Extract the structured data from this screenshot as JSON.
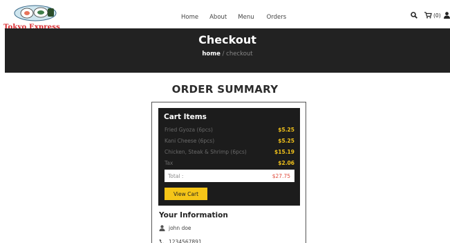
{
  "brand": {
    "name": "Tokyo Express",
    "color": "#d7262b"
  },
  "nav": {
    "items": [
      "Home",
      "About",
      "Menu",
      "Orders"
    ]
  },
  "header": {
    "cart_count": "(0)",
    "icons": [
      "search-icon",
      "cart-icon",
      "user-icon"
    ]
  },
  "banner": {
    "title": "Checkout",
    "breadcrumb_home": "home",
    "breadcrumb_sep": "/",
    "breadcrumb_current": "checkout"
  },
  "summary": {
    "title": "ORDER SUMMARY"
  },
  "cart": {
    "heading": "Cart Items",
    "items": [
      {
        "name": "Fried Gyoza (6pcs)",
        "price": "$5.25"
      },
      {
        "name": "Kani Cheese (6pcs)",
        "price": "$5.25"
      },
      {
        "name": "Chicken, Steak & Shrimp (6pcs)",
        "price": "$15.19"
      },
      {
        "name": "Tax",
        "price": "$2.06"
      }
    ],
    "total_label": "Total :",
    "total_value": "$27.75",
    "view_cart_label": "View Cart"
  },
  "info": {
    "heading": "Your Information",
    "name": "john doe",
    "phone": "1234567891"
  },
  "colors": {
    "banner": "#222222",
    "accent": "#f5c518",
    "price": "#f2c21b",
    "total": "#e04a3a"
  }
}
